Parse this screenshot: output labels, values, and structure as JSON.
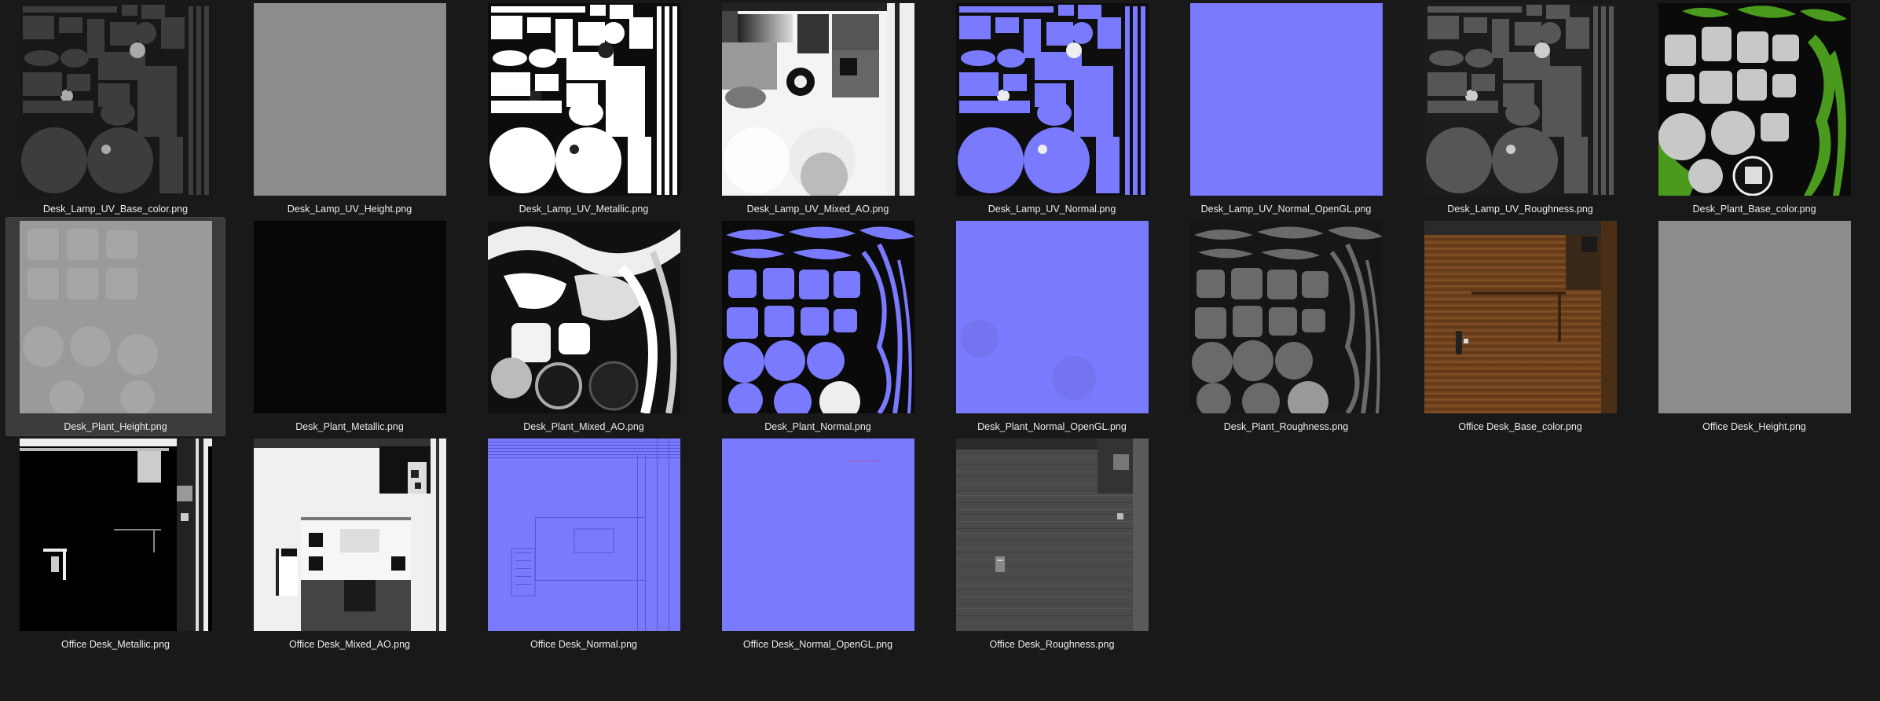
{
  "files": [
    {
      "name": "Desk_Lamp_UV_Base_color.png",
      "kind": "lamp_base"
    },
    {
      "name": "Desk_Lamp_UV_Height.png",
      "kind": "flat_gray"
    },
    {
      "name": "Desk_Lamp_UV_Metallic.png",
      "kind": "lamp_metallic"
    },
    {
      "name": "Desk_Lamp_UV_Mixed_AO.png",
      "kind": "lamp_ao"
    },
    {
      "name": "Desk_Lamp_UV_Normal.png",
      "kind": "lamp_normal"
    },
    {
      "name": "Desk_Lamp_UV_Normal_OpenGL.png",
      "kind": "flat_normal"
    },
    {
      "name": "Desk_Lamp_UV_Roughness.png",
      "kind": "lamp_rough"
    },
    {
      "name": "Desk_Plant_Base_color.png",
      "kind": "plant_base"
    },
    {
      "name": "Desk_Plant_Height.png",
      "kind": "plant_height",
      "selected": true
    },
    {
      "name": "Desk_Plant_Metallic.png",
      "kind": "black"
    },
    {
      "name": "Desk_Plant_Mixed_AO.png",
      "kind": "plant_ao"
    },
    {
      "name": "Desk_Plant_Normal.png",
      "kind": "plant_normal"
    },
    {
      "name": "Desk_Plant_Normal_OpenGL.png",
      "kind": "flat_normal_plant"
    },
    {
      "name": "Desk_Plant_Roughness.png",
      "kind": "plant_rough"
    },
    {
      "name": "Office Desk_Base_color.png",
      "kind": "desk_wood"
    },
    {
      "name": "Office Desk_Height.png",
      "kind": "flat_gray"
    },
    {
      "name": "Office Desk_Metallic.png",
      "kind": "desk_metallic"
    },
    {
      "name": "Office Desk_Mixed_AO.png",
      "kind": "desk_ao"
    },
    {
      "name": "Office Desk_Normal.png",
      "kind": "desk_normal"
    },
    {
      "name": "Office Desk_Normal_OpenGL.png",
      "kind": "flat_normal_desk"
    },
    {
      "name": "Office Desk_Roughness.png",
      "kind": "desk_rough"
    }
  ],
  "colors": {
    "background": "#191919",
    "normal_blue": "#7a7aff",
    "leaf_green": "#4a9a1e",
    "wood_brown": "#7a4a22",
    "selection": "#3b3b3b"
  }
}
